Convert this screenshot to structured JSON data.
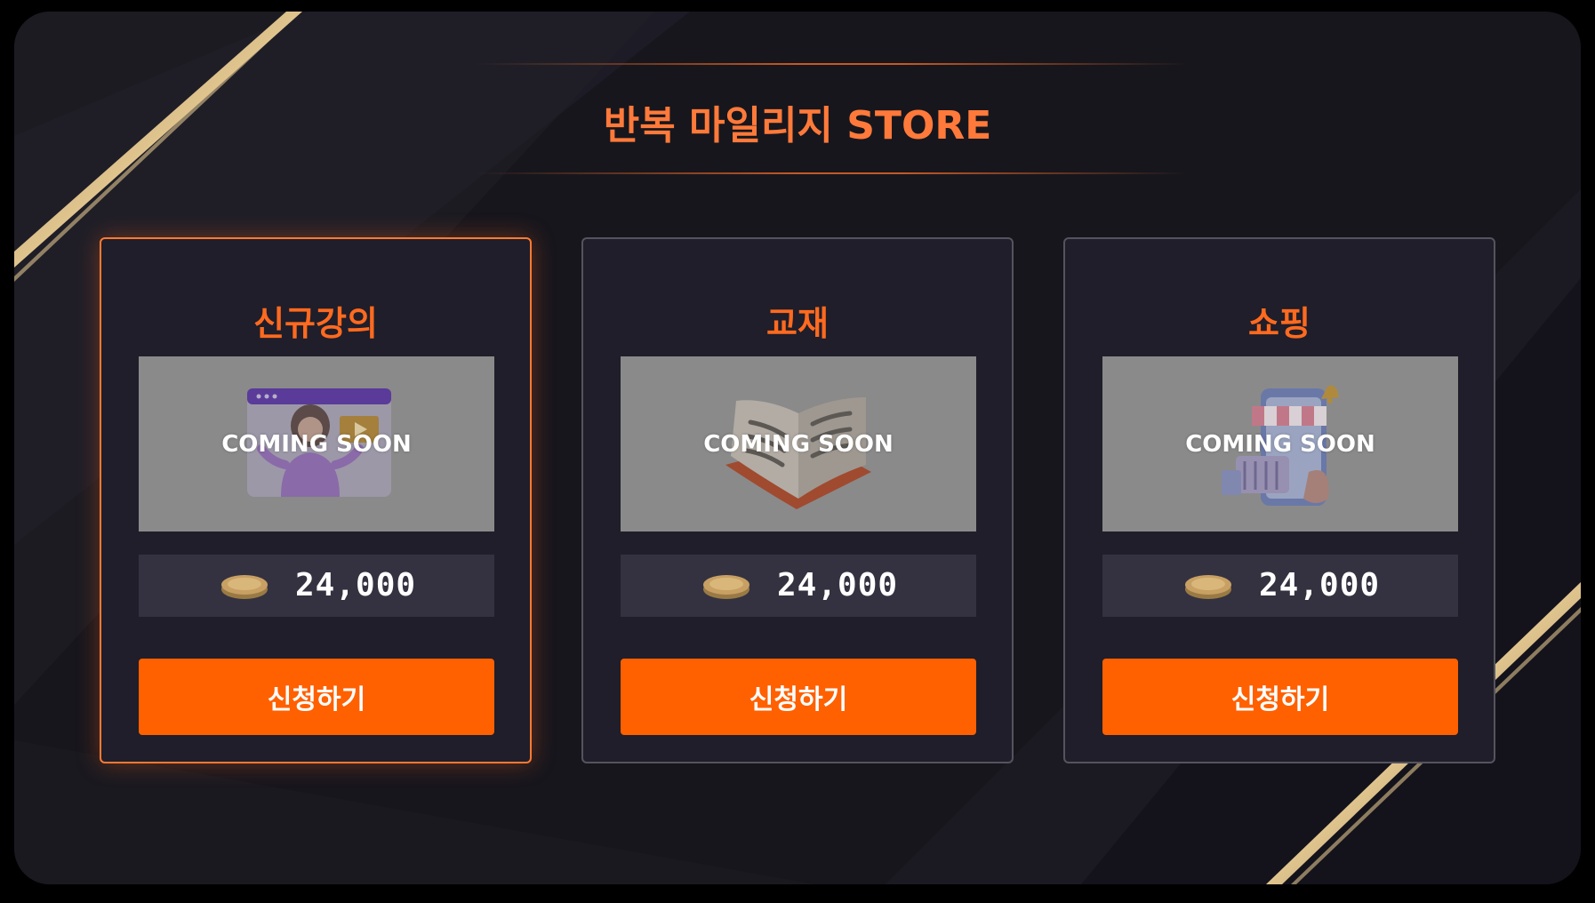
{
  "store": {
    "title": "반복 마일리지 STORE"
  },
  "cards": [
    {
      "title": "신규강의",
      "overlay": "COMING SOON",
      "illustration": "woman-video-lecture-icon",
      "coin_icon": "gold-coin-icon",
      "price": "24,000",
      "button": "신청하기",
      "active": true
    },
    {
      "title": "교재",
      "overlay": "COMING SOON",
      "illustration": "open-book-icon",
      "coin_icon": "gold-coin-icon",
      "price": "24,000",
      "button": "신청하기",
      "active": false
    },
    {
      "title": "쇼핑",
      "overlay": "COMING SOON",
      "illustration": "mobile-shopping-store-icon",
      "coin_icon": "gold-coin-icon",
      "price": "24,000",
      "button": "신청하기",
      "active": false
    }
  ],
  "colors": {
    "accent": "#ff6000",
    "title": "#ff7a3a",
    "card_bg": "#1f1e2a",
    "page_bg": "#17161d",
    "price_bg": "#343240",
    "gold": "#c8a064"
  }
}
